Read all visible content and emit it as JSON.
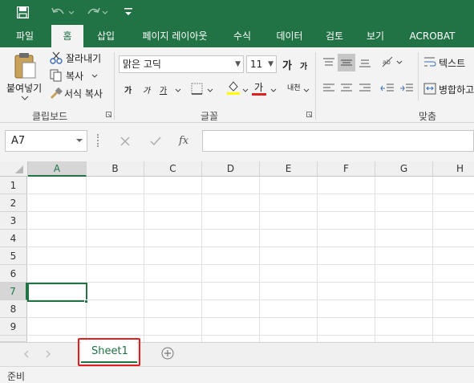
{
  "tabs": [
    "파일",
    "홈",
    "삽입",
    "페이지 레이아웃",
    "수식",
    "데이터",
    "검토",
    "보기",
    "ACROBAT"
  ],
  "clipboard": {
    "paste_label": "붙여넣기",
    "cut_label": "잘라내기",
    "copy_label": "복사",
    "format_painter_label": "서식 복사",
    "group_label": "클립보드"
  },
  "font": {
    "name": "맑은 고딕",
    "size": "11",
    "grow_label": "가",
    "shrink_label": "가",
    "bold_label": "가",
    "italic_label": "가",
    "underline_label": "가",
    "font_color_label": "가",
    "phonetic_label": "내천",
    "group_label": "글꼴"
  },
  "alignment": {
    "wrap_text_label": "텍스트",
    "merge_label": "병합하고",
    "group_label": "맞춤"
  },
  "formula_bar": {
    "name_box": "A7",
    "fx_label": "fx",
    "formula": ""
  },
  "columns": [
    "A",
    "B",
    "C",
    "D",
    "E",
    "F",
    "G",
    "H"
  ],
  "rows": [
    "1",
    "2",
    "3",
    "4",
    "5",
    "6",
    "7",
    "8",
    "9"
  ],
  "selected_cell": "A7",
  "sheets": [
    {
      "name": "Sheet1",
      "active": true
    }
  ],
  "status": {
    "text": "준비"
  },
  "colors": {
    "accent": "#217346",
    "highlight_box": "#e02020",
    "font_color_bar": "#e02020",
    "highlight_color_bar": "#ffff00"
  }
}
